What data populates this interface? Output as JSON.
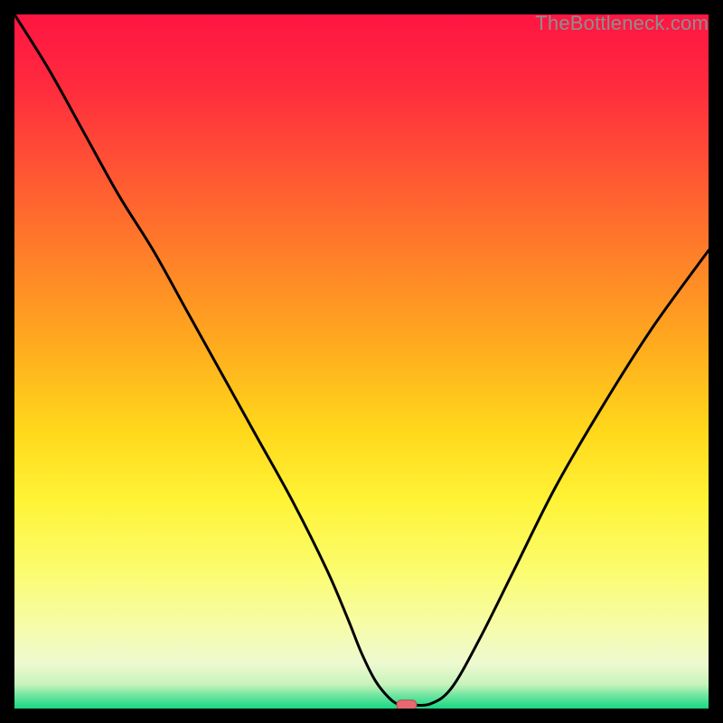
{
  "watermark": "TheBottleneck.com",
  "colors": {
    "gradient_stops": [
      {
        "offset": 0.0,
        "color": "#ff1543"
      },
      {
        "offset": 0.1,
        "color": "#ff2a3e"
      },
      {
        "offset": 0.22,
        "color": "#ff5334"
      },
      {
        "offset": 0.35,
        "color": "#ff8028"
      },
      {
        "offset": 0.48,
        "color": "#ffac1e"
      },
      {
        "offset": 0.6,
        "color": "#ffd81b"
      },
      {
        "offset": 0.7,
        "color": "#fff336"
      },
      {
        "offset": 0.8,
        "color": "#fbfc6d"
      },
      {
        "offset": 0.88,
        "color": "#f6fca8"
      },
      {
        "offset": 0.935,
        "color": "#eef9d0"
      },
      {
        "offset": 0.965,
        "color": "#c8f3bb"
      },
      {
        "offset": 0.985,
        "color": "#5be29a"
      },
      {
        "offset": 1.0,
        "color": "#18d882"
      }
    ],
    "curve": "#000000",
    "marker_fill": "#e46a6f",
    "marker_stroke": "#b94a4f",
    "background": "#000000"
  },
  "chart_data": {
    "type": "line",
    "title": "",
    "xlabel": "",
    "ylabel": "",
    "xlim": [
      0,
      100
    ],
    "ylim": [
      0,
      100
    ],
    "grid": false,
    "legend": false,
    "x": [
      0,
      5,
      10,
      15,
      20,
      25,
      30,
      35,
      40,
      45,
      48,
      50,
      52,
      54,
      55.5,
      57,
      60,
      63,
      67,
      72,
      78,
      85,
      92,
      100
    ],
    "values": [
      100,
      92,
      83,
      74,
      66,
      57,
      48,
      39,
      30,
      20,
      13,
      8,
      4,
      1.5,
      0.5,
      0.5,
      0.7,
      3,
      10,
      20,
      32,
      44,
      55,
      66
    ],
    "marker": {
      "x": 56.5,
      "y": 0.5
    },
    "notes": "y (0-100) is visual height as a fraction of the plot; the curve is a bottleneck-vs-balance curve with minimum near x≈56 and a short flat bottom between x≈54.5 and x≈57.5."
  }
}
